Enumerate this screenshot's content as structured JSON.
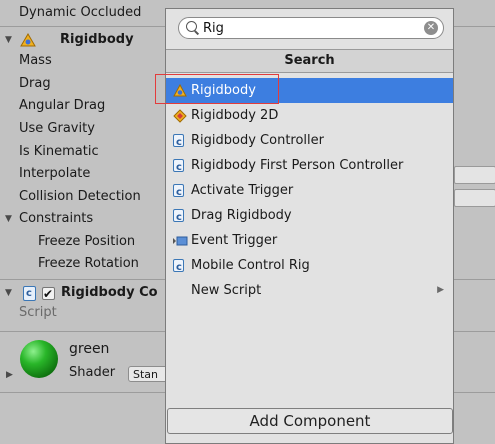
{
  "inspector": {
    "top_row_label": "Dynamic Occluded",
    "rigidbody": {
      "title": "Rigidbody",
      "props": [
        "Mass",
        "Drag",
        "Angular Drag",
        "Use Gravity",
        "Is Kinematic",
        "Interpolate",
        "Collision Detection"
      ],
      "constraints_label": "Constraints",
      "freeze_position": "Freeze Position",
      "freeze_rotation": "Freeze Rotation"
    },
    "rigidbody_controller": {
      "title": "Rigidbody Co",
      "script_label": "Script"
    },
    "material": {
      "name": "green",
      "shader_label": "Shader",
      "shader_value": "Stan"
    }
  },
  "popup": {
    "search_value": "Rig",
    "header": "Search",
    "results": [
      {
        "label": "Rigidbody",
        "icon": "rigidbody-icon"
      },
      {
        "label": "Rigidbody 2D",
        "icon": "rigidbody2d-icon"
      },
      {
        "label": "Rigidbody Controller",
        "icon": "script-icon"
      },
      {
        "label": "Rigidbody First Person Controller",
        "icon": "script-icon"
      },
      {
        "label": "Activate Trigger",
        "icon": "script-icon"
      },
      {
        "label": "Drag Rigidbody",
        "icon": "script-icon"
      },
      {
        "label": "Event Trigger",
        "icon": "event-trigger-icon"
      },
      {
        "label": "Mobile Control Rig",
        "icon": "script-icon"
      },
      {
        "label": "New Script",
        "icon": "submenu-arrow-icon"
      }
    ]
  },
  "add_component_label": "Add Component"
}
